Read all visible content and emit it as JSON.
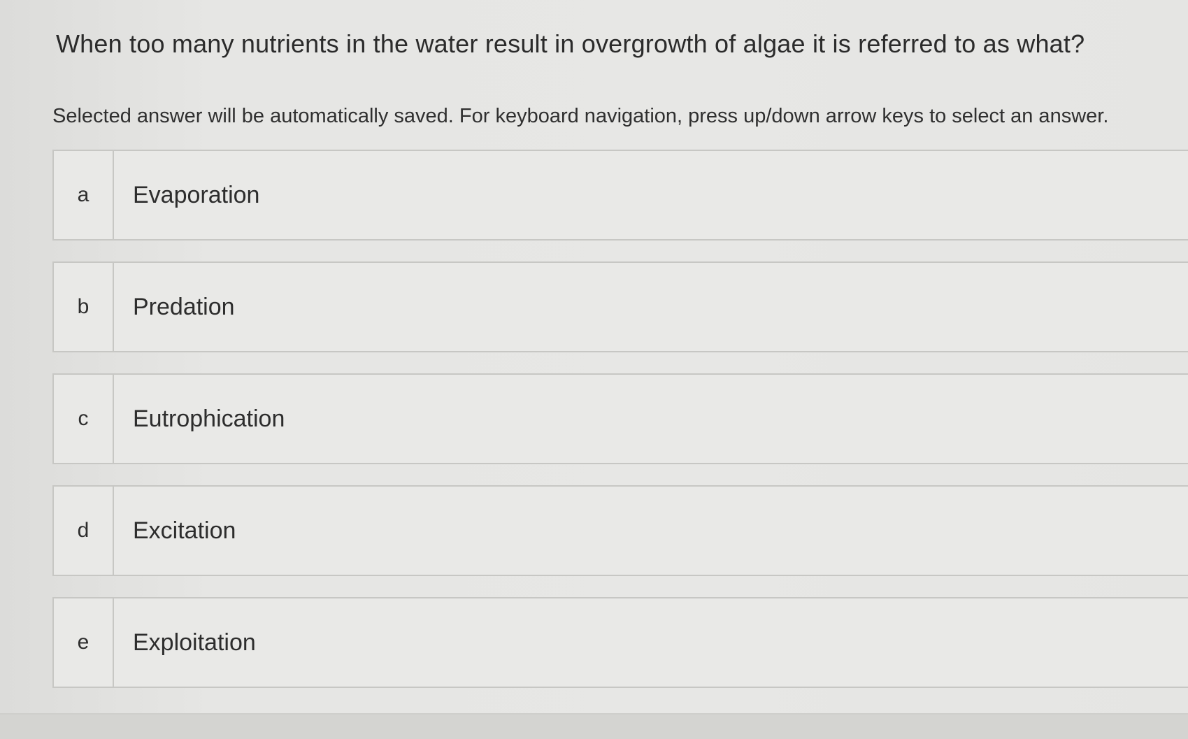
{
  "question": {
    "text": "When too many nutrients in the water result in overgrowth of algae it is referred to as what?"
  },
  "instructions": "Selected answer will be automatically saved. For keyboard navigation, press up/down arrow keys to select an answer.",
  "options": [
    {
      "letter": "a",
      "label": "Evaporation"
    },
    {
      "letter": "b",
      "label": "Predation"
    },
    {
      "letter": "c",
      "label": "Eutrophication"
    },
    {
      "letter": "d",
      "label": "Excitation"
    },
    {
      "letter": "e",
      "label": "Exploitation"
    }
  ]
}
